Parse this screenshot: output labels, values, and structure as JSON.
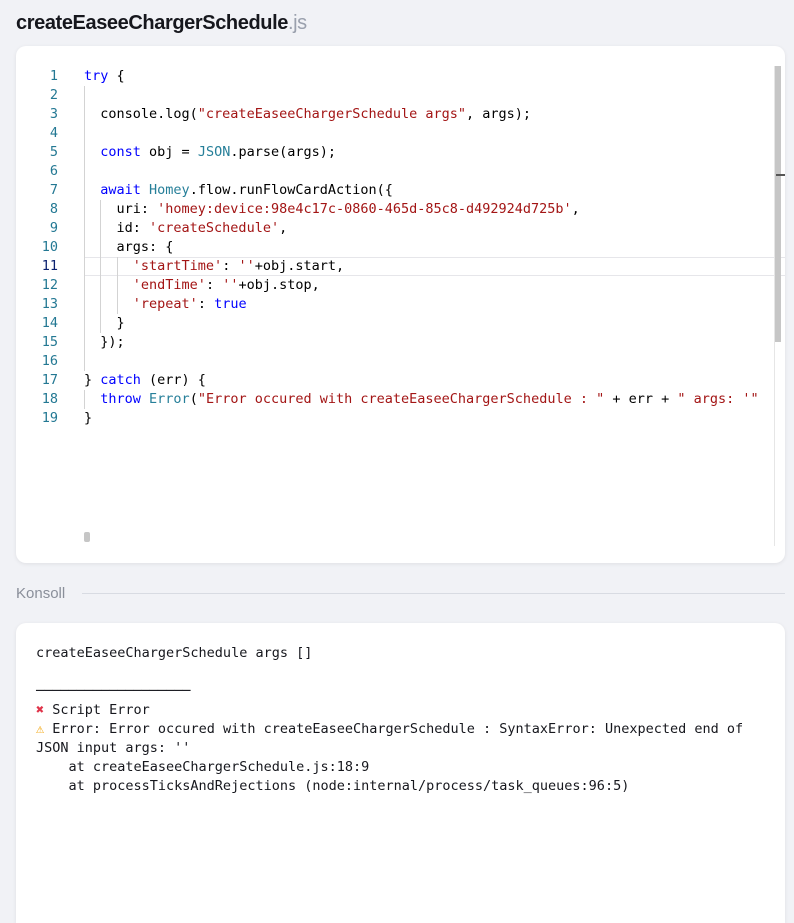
{
  "header": {
    "file_name": "createEaseeChargerSchedule",
    "file_ext": ".js"
  },
  "editor": {
    "lines": [
      {
        "n": "1",
        "html": "<span class=\"kw\">try</span> {"
      },
      {
        "n": "2",
        "html": ""
      },
      {
        "n": "3",
        "html": "  console.log(<span class=\"str\">\"createEaseeChargerSchedule args\"</span>, args);"
      },
      {
        "n": "4",
        "html": ""
      },
      {
        "n": "5",
        "html": "  <span class=\"kw\">const</span> obj = <span class=\"typ\">JSON</span>.parse(args);"
      },
      {
        "n": "6",
        "html": ""
      },
      {
        "n": "7",
        "html": "  <span class=\"kw\">await</span> <span class=\"typ\">Homey</span>.flow.runFlowCardAction({"
      },
      {
        "n": "8",
        "html": "    uri: <span class=\"str\">'homey:device:98e4c17c-0860-465d-85c8-d492924d725b'</span>,"
      },
      {
        "n": "9",
        "html": "    id: <span class=\"str\">'createSchedule'</span>,"
      },
      {
        "n": "10",
        "html": "    args: {"
      },
      {
        "n": "11",
        "html": "      <span class=\"str\">'startTime'</span>: <span class=\"str\">''</span>+obj.start,",
        "active": true
      },
      {
        "n": "12",
        "html": "      <span class=\"str\">'endTime'</span>: <span class=\"str\">''</span>+obj.stop,"
      },
      {
        "n": "13",
        "html": "      <span class=\"str\">'repeat'</span>: <span class=\"kw\">true</span>"
      },
      {
        "n": "14",
        "html": "    }"
      },
      {
        "n": "15",
        "html": "  });"
      },
      {
        "n": "16",
        "html": ""
      },
      {
        "n": "17",
        "html": "} <span class=\"kw\">catch</span> (err) {"
      },
      {
        "n": "18",
        "html": "  <span class=\"kw\">throw</span> <span class=\"typ\">Error</span>(<span class=\"str\">\"Error occured with createEaseeChargerSchedule : \"</span> + err + <span class=\"str\">\" args: '\"</span>"
      },
      {
        "n": "19",
        "html": "}"
      }
    ]
  },
  "console": {
    "label": "Konsoll",
    "log_line": "createEaseeChargerSchedule args []",
    "divider": "───────────────────",
    "error_symbol": "✖",
    "error_title": " Script Error",
    "warn_symbol": "⚠",
    "error_message": " Error: Error occured with createEaseeChargerSchedule : SyntaxError: Unexpected end of JSON input args: ''",
    "stack": [
      "    at createEaseeChargerSchedule.js:18:9",
      "    at processTicksAndRejections (node:internal/process/task_queues:96:5)"
    ]
  },
  "colors": {
    "keyword": "#0000ff",
    "string": "#a31515",
    "type": "#267f99",
    "line_number": "#237893",
    "error": "#e0344a",
    "warning": "#f2a100"
  }
}
